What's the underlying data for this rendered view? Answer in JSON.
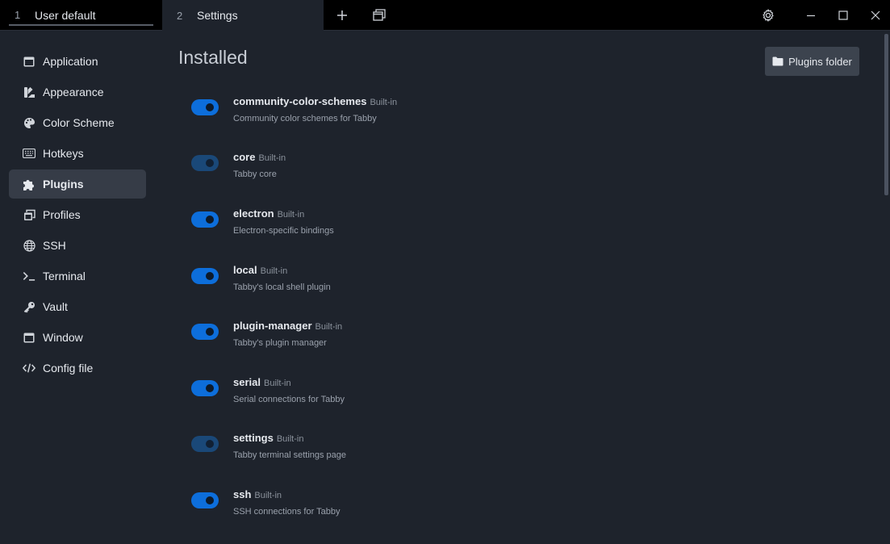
{
  "tabs": [
    {
      "number": "1",
      "title": "User default"
    },
    {
      "number": "2",
      "title": "Settings"
    }
  ],
  "titlebar_icons": [
    "plus-icon",
    "window-stack-icon",
    "gear-icon",
    "minimize-icon",
    "maximize-icon",
    "close-icon"
  ],
  "sidebar": {
    "items": [
      {
        "label": "Application",
        "icon": "window-icon"
      },
      {
        "label": "Appearance",
        "icon": "palette-swatch-icon"
      },
      {
        "label": "Color Scheme",
        "icon": "palette-icon"
      },
      {
        "label": "Hotkeys",
        "icon": "keyboard-icon"
      },
      {
        "label": "Plugins",
        "icon": "puzzle-icon",
        "active": true
      },
      {
        "label": "Profiles",
        "icon": "window-stack-icon"
      },
      {
        "label": "SSH",
        "icon": "globe-icon"
      },
      {
        "label": "Terminal",
        "icon": "terminal-icon"
      },
      {
        "label": "Vault",
        "icon": "key-icon"
      },
      {
        "label": "Window",
        "icon": "window-icon"
      },
      {
        "label": "Config file",
        "icon": "code-icon"
      }
    ]
  },
  "main": {
    "title": "Installed",
    "plugins_folder_label": "Plugins folder",
    "plugins": [
      {
        "name": "community-color-schemes",
        "badge": "Built-in",
        "description": "Community color schemes for Tabby",
        "enabled": true,
        "locked": false
      },
      {
        "name": "core",
        "badge": "Built-in",
        "description": "Tabby core",
        "enabled": true,
        "locked": true
      },
      {
        "name": "electron",
        "badge": "Built-in",
        "description": "Electron-specific bindings",
        "enabled": true,
        "locked": false
      },
      {
        "name": "local",
        "badge": "Built-in",
        "description": "Tabby's local shell plugin",
        "enabled": true,
        "locked": false
      },
      {
        "name": "plugin-manager",
        "badge": "Built-in",
        "description": "Tabby's plugin manager",
        "enabled": true,
        "locked": false
      },
      {
        "name": "serial",
        "badge": "Built-in",
        "description": "Serial connections for Tabby",
        "enabled": true,
        "locked": false
      },
      {
        "name": "settings",
        "badge": "Built-in",
        "description": "Tabby terminal settings page",
        "enabled": true,
        "locked": true
      },
      {
        "name": "ssh",
        "badge": "Built-in",
        "description": "SSH connections for Tabby",
        "enabled": true,
        "locked": false
      }
    ]
  },
  "colors": {
    "accent": "#0d6edb",
    "background": "#1e232c",
    "titlebar": "#000000",
    "active_item": "#363c47"
  }
}
